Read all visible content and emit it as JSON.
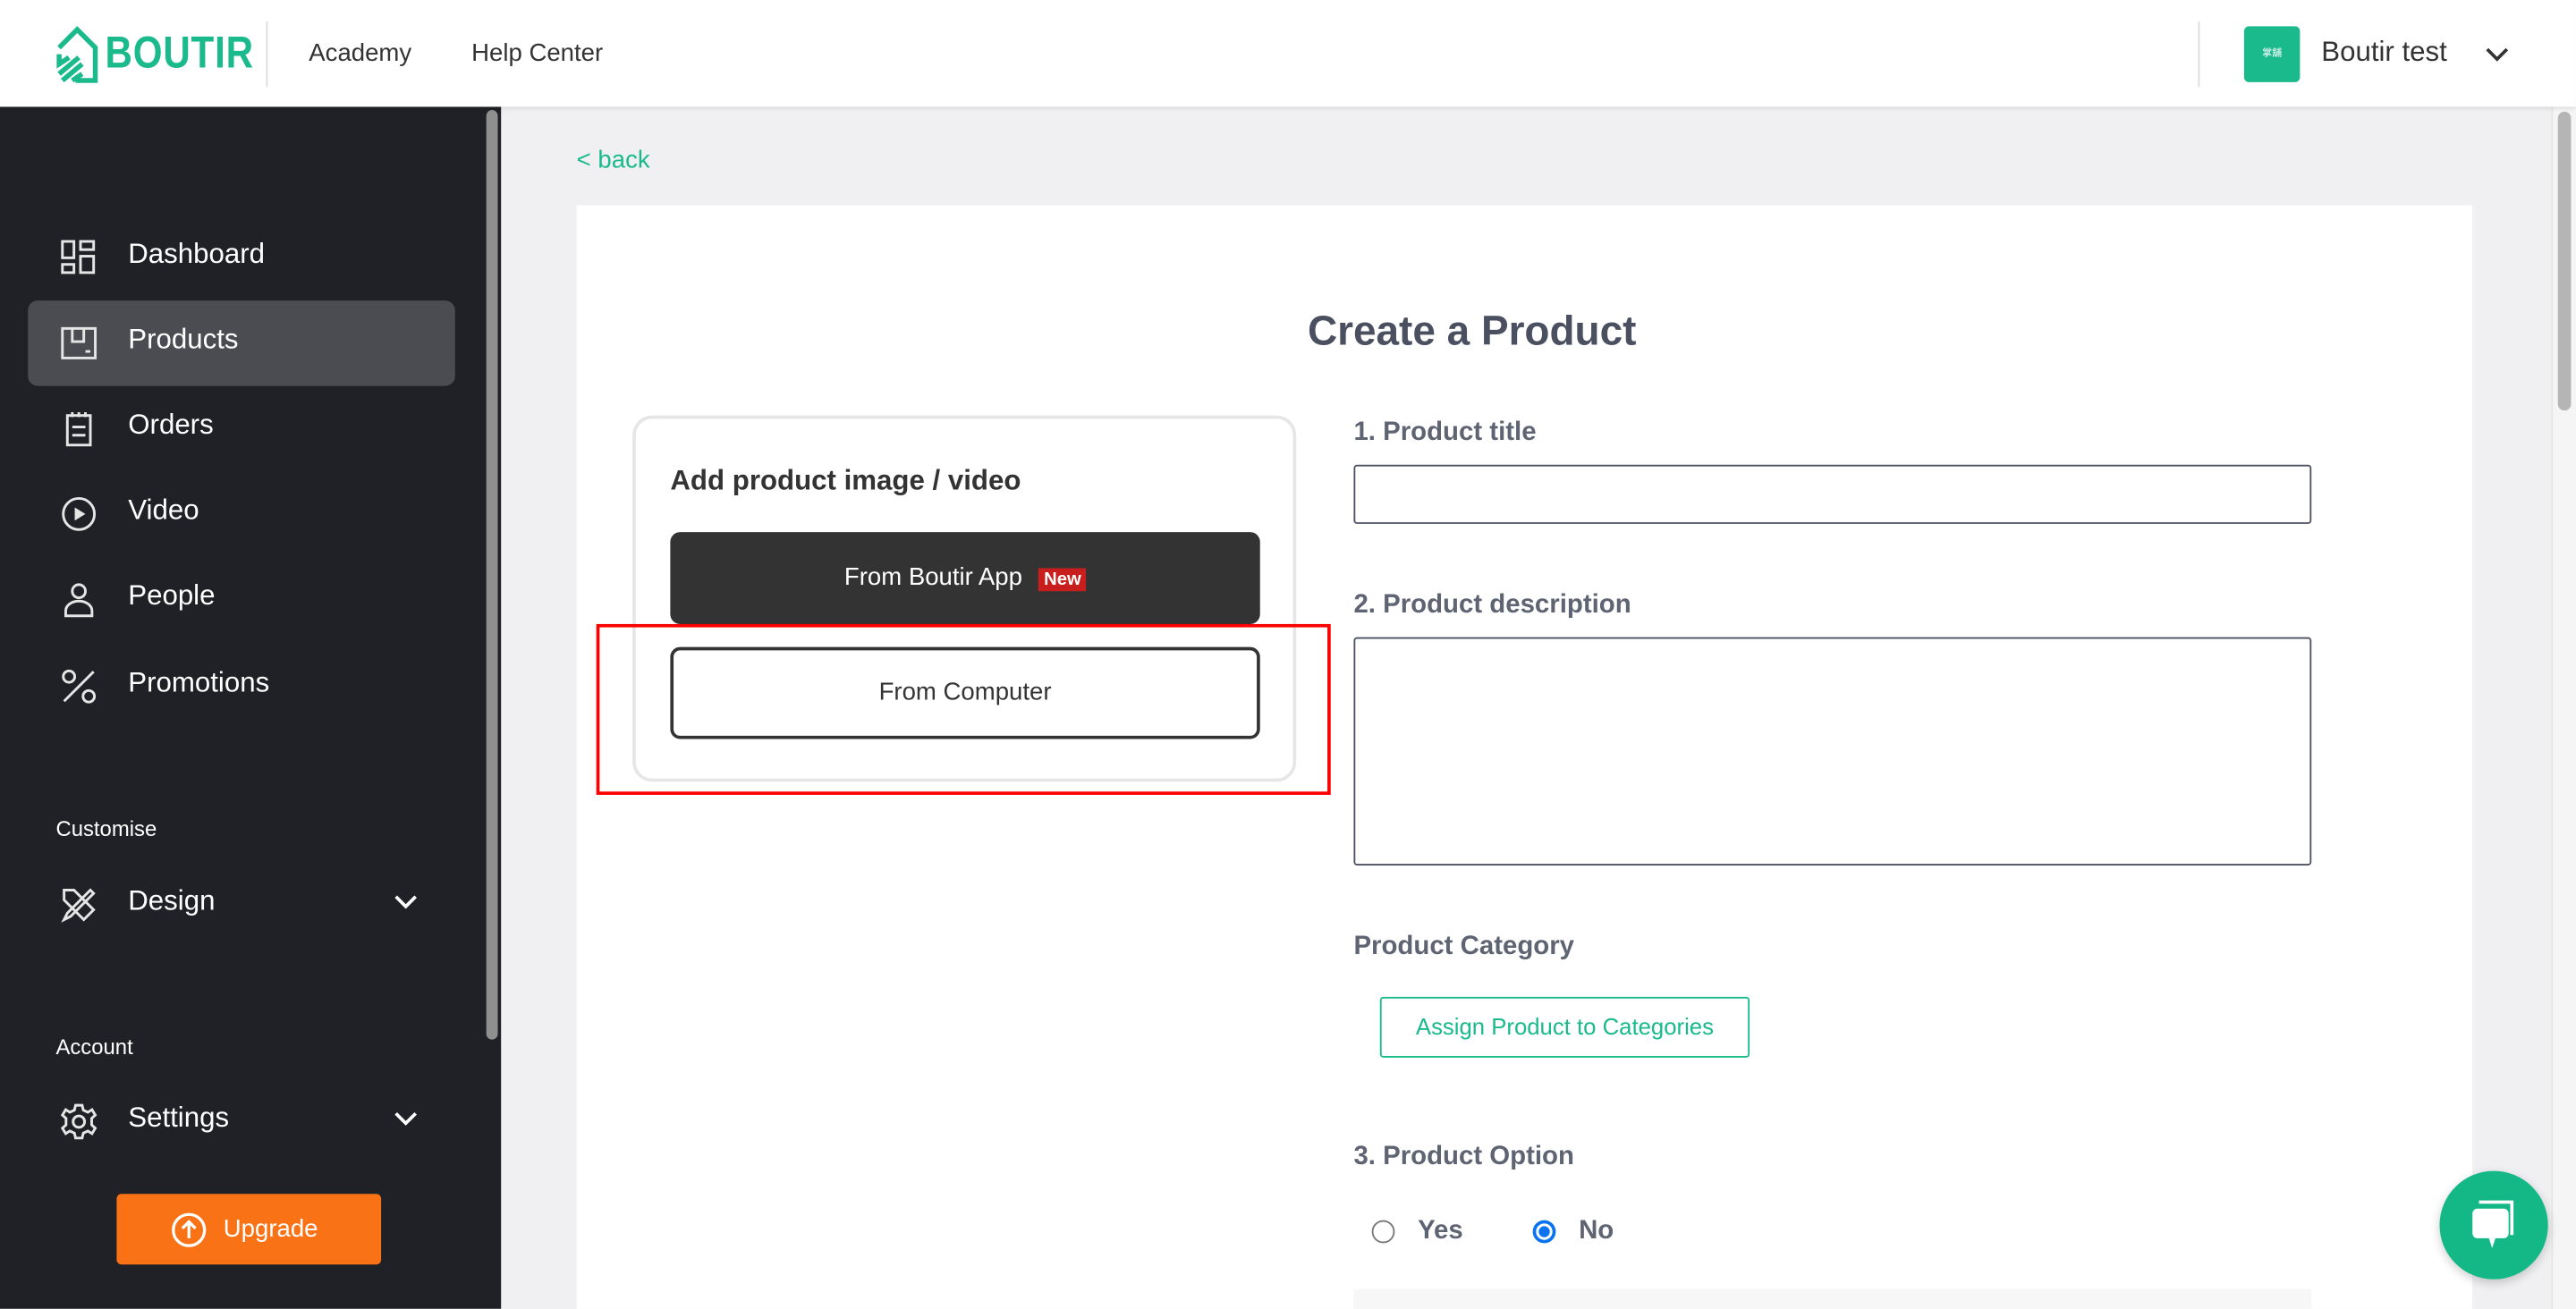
{
  "header": {
    "brand": "BOUTIR",
    "nav": [
      "Academy",
      "Help Center"
    ],
    "account_name": "Boutir test",
    "avatar_text": "掌舖 BOUTIR"
  },
  "sidebar": {
    "items": [
      {
        "label": "Dashboard",
        "icon": "dashboard-icon"
      },
      {
        "label": "Products",
        "icon": "products-icon",
        "active": true
      },
      {
        "label": "Orders",
        "icon": "orders-icon"
      },
      {
        "label": "Video",
        "icon": "video-icon"
      },
      {
        "label": "People",
        "icon": "people-icon"
      },
      {
        "label": "Promotions",
        "icon": "percent-icon"
      }
    ],
    "customise": {
      "heading": "Customise",
      "design": "Design"
    },
    "account": {
      "heading": "Account",
      "settings": "Settings"
    },
    "upgrade": "Upgrade"
  },
  "main": {
    "back": "< back",
    "title": "Create a Product",
    "media": {
      "heading": "Add product image / video",
      "from_app": "From Boutir App",
      "new_badge": "New",
      "from_computer": "From Computer"
    },
    "product_title": {
      "label": "1. Product title",
      "value": ""
    },
    "product_description": {
      "label": "2. Product description",
      "value": ""
    },
    "category": {
      "label": "Product Category",
      "button": "Assign Product to Categories"
    },
    "option": {
      "label": "3. Product Option",
      "yes": "Yes",
      "no": "No",
      "selected": "No"
    }
  },
  "colors": {
    "brand": "#1aba8c",
    "sidebar": "#202126",
    "upgrade": "#f97316",
    "highlight": "#ff0000",
    "radio": "#0a74f0"
  }
}
